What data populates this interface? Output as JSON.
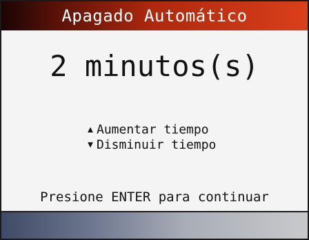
{
  "header": {
    "title": "Apagado Automático"
  },
  "main": {
    "value_display": "2 minutos(s)",
    "options": [
      {
        "icon": "triangle-up-icon",
        "glyph": "▲",
        "label": "Aumentar tiempo"
      },
      {
        "icon": "triangle-down-icon",
        "glyph": "▼",
        "label": "Disminuir tiempo"
      }
    ],
    "prompt": "Presione ENTER para continuar"
  },
  "colors": {
    "title_bar_start": "#1a0505",
    "title_bar_end": "#d9401a",
    "bottom_bar_start": "#3f4a66",
    "bottom_bar_end": "#c9c9cb"
  }
}
